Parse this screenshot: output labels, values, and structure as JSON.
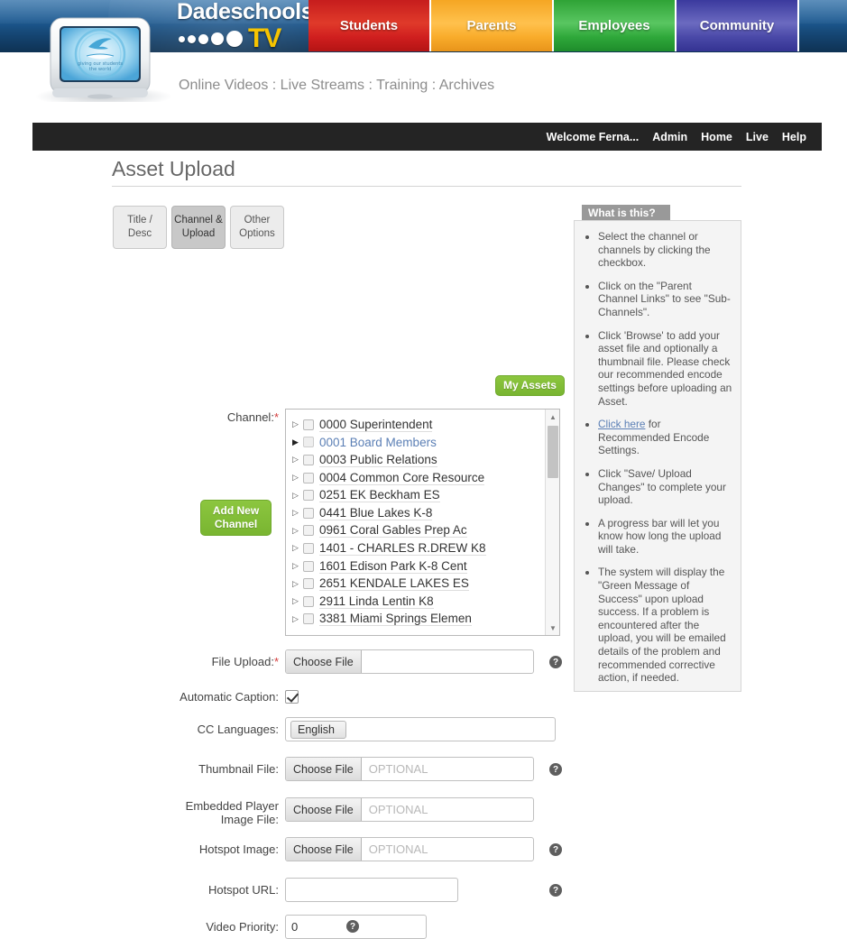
{
  "banner": {
    "brand_word": "Dadeschools",
    "brand_tv": "TV",
    "logo_alt": "dadeschools-tv-logo",
    "nav": [
      {
        "label": "Students",
        "color": "#d01f1f"
      },
      {
        "label": "Parents",
        "color": "#f9ac2b"
      },
      {
        "label": "Employees",
        "color": "#2fa83a"
      },
      {
        "label": "Community",
        "color": "#4a49a8"
      }
    ],
    "breadcrumb": "Online Videos : Live Streams : Training : Archives"
  },
  "topbar": {
    "welcome": "Welcome Ferna...",
    "links": [
      "Admin",
      "Home",
      "Live",
      "Help"
    ]
  },
  "page": {
    "title": "Asset Upload",
    "tabs": [
      {
        "label_line1": "Title /",
        "label_line2": "Desc",
        "active": false
      },
      {
        "label_line1": "Channel &",
        "label_line2": "Upload",
        "active": true
      },
      {
        "label_line1": "Other",
        "label_line2": "Options",
        "active": false
      }
    ],
    "my_assets_label": "My Assets",
    "add_channel_line1": "Add New",
    "add_channel_line2": "Channel"
  },
  "form": {
    "channel_label": "Channel:",
    "channel_required": "*",
    "channels": [
      {
        "code": "0000",
        "name": "Superintendent",
        "text": "0000 Superintendent",
        "expanded": false,
        "selected": false
      },
      {
        "code": "0001",
        "name": "Board Members",
        "text": "0001 Board Members",
        "expanded": true,
        "selected": true
      },
      {
        "code": "0003",
        "name": "Public Relations",
        "text": "0003 Public Relations",
        "expanded": false,
        "selected": false
      },
      {
        "code": "0004",
        "name": "Common Core Resource",
        "text": "0004 Common Core Resource",
        "expanded": false,
        "selected": false
      },
      {
        "code": "0251",
        "name": "EK Beckham ES",
        "text": "0251 EK Beckham ES",
        "expanded": false,
        "selected": false
      },
      {
        "code": "0441",
        "name": "Blue Lakes K-8",
        "text": "0441 Blue Lakes K-8",
        "expanded": false,
        "selected": false
      },
      {
        "code": "0961",
        "name": "Coral Gables Prep Ac",
        "text": "0961 Coral Gables Prep Ac",
        "expanded": false,
        "selected": false
      },
      {
        "code": "1401",
        "name": "- CHARLES R.DREW K8",
        "text": "1401 - CHARLES R.DREW K8",
        "expanded": false,
        "selected": false
      },
      {
        "code": "1601",
        "name": "Edison Park K-8 Cent",
        "text": "1601 Edison Park K-8 Cent",
        "expanded": false,
        "selected": false
      },
      {
        "code": "2651",
        "name": "KENDALE LAKES ES",
        "text": "2651 KENDALE LAKES ES",
        "expanded": false,
        "selected": false
      },
      {
        "code": "2911",
        "name": "Linda Lentin K8",
        "text": "2911 Linda Lentin K8",
        "expanded": false,
        "selected": false
      },
      {
        "code": "3381",
        "name": "Miami Springs Elemen",
        "text": "3381 Miami Springs Elemen",
        "expanded": false,
        "selected": false
      }
    ],
    "file_upload_label": "File Upload:",
    "file_upload_required": "*",
    "choose_file_label": "Choose File",
    "file_upload_value": "",
    "automatic_caption_label": "Automatic Caption:",
    "automatic_caption_checked": true,
    "cc_languages_label": "CC Languages:",
    "cc_language_tag": "English",
    "thumbnail_label": "Thumbnail File:",
    "thumbnail_placeholder": "OPTIONAL",
    "embedded_label_line1": "Embedded Player",
    "embedded_label_line2": "Image File:",
    "embedded_placeholder": "OPTIONAL",
    "hotspot_image_label": "Hotspot Image:",
    "hotspot_image_placeholder": "OPTIONAL",
    "hotspot_url_label": "Hotspot URL:",
    "hotspot_url_value": "",
    "video_priority_label": "Video Priority:",
    "video_priority_value": "0",
    "help_glyph": "?"
  },
  "sidebar": {
    "heading": "What is this?",
    "items": [
      "Select the channel or channels by clicking the checkbox.",
      "Click on the \"Parent Channel Links\" to see \"Sub-Channels\".",
      "Click 'Browse' to add your asset file and optionally a thumbnail file. Please check our recommended encode settings before uploading an Asset.",
      "Click \"Save/ Upload Changes\" to complete your upload.",
      "A progress bar will let you know how long the upload will take.",
      "The system will display the \"Green Message of Success\" upon upload success. If a problem is encountered after the upload, you will be emailed details of the problem and recommended corrective action, if needed."
    ],
    "link_item": {
      "link_text": "Click here",
      "rest": " for Recommended Encode Settings."
    }
  },
  "colors": {
    "accent_green": "#8cc63f",
    "link_blue": "#5b7fb5",
    "required_red": "#d33a3a",
    "topbar_dark": "#242424"
  }
}
